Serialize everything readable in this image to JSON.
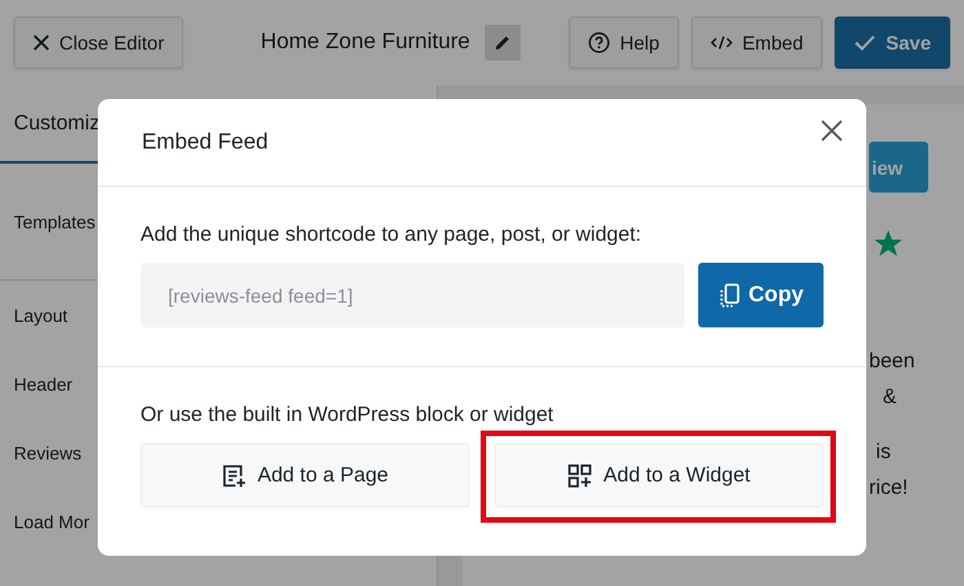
{
  "topbar": {
    "close_button": "Close Editor",
    "feed_title": "Home Zone Furniture",
    "buttons": [
      {
        "label": "Help",
        "kind": "help"
      },
      {
        "label": "Embed",
        "kind": "embed"
      },
      {
        "label": "Save",
        "kind": "save"
      }
    ]
  },
  "sidebar": {
    "tab": "Customiz",
    "items": [
      "Templates",
      "Layout",
      "Header",
      "Reviews",
      "Load Mor"
    ]
  },
  "preview": {
    "button": "iew",
    "text_lines": [
      "been",
      "&",
      "is",
      "rice!"
    ]
  },
  "modal": {
    "title": "Embed Feed",
    "shortcode_label": "Add the unique shortcode to any page, post, or widget:",
    "shortcode": "[reviews-feed feed=1]",
    "copy_button": "Copy",
    "block_label": "Or use the built in WordPress block or widget",
    "options": [
      {
        "label": "Add to a Page",
        "kind": "page",
        "highlighted": false
      },
      {
        "label": "Add to a Widget",
        "kind": "widget",
        "highlighted": true
      }
    ]
  }
}
